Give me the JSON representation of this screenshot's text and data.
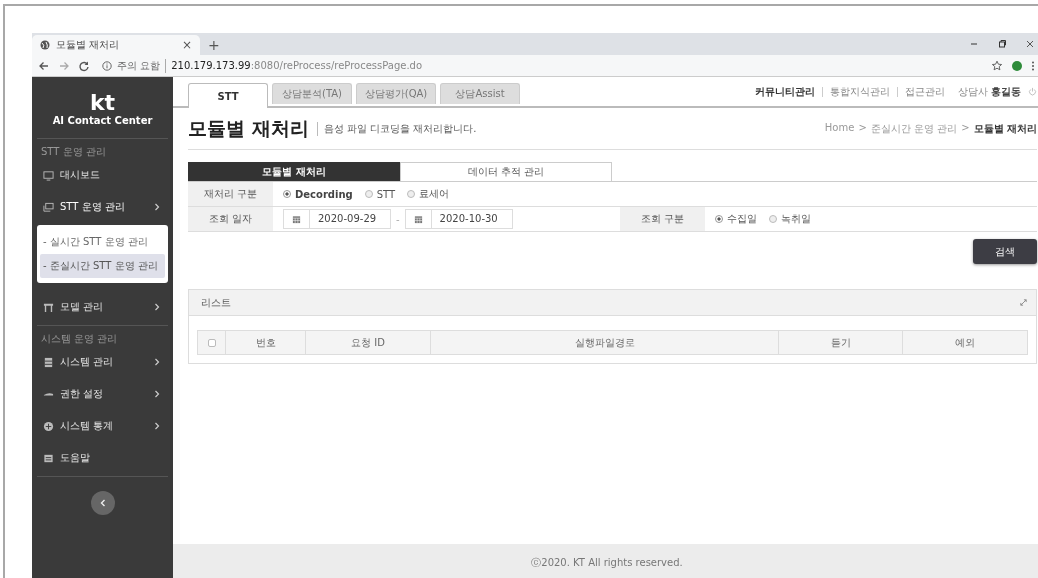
{
  "browser": {
    "tab_title": "모듈별 재처리",
    "tab_close": "×",
    "new_tab": "+",
    "security_label": "주의 요함",
    "url_host": "210.179.173.99",
    "url_path": ":8080/reProcess/reProcessPage.do"
  },
  "sidebar": {
    "logo": "kt",
    "subtitle": "AI Contact Center",
    "sections": [
      {
        "label": "STT 운영 관리",
        "items": [
          {
            "label": "대시보드",
            "has_arrow": false
          },
          {
            "label": "STT 운영 관리",
            "has_arrow": true,
            "expanded": true,
            "children": [
              {
                "label": "- 실시간 STT 운영 관리",
                "selected": false
              },
              {
                "label": "- 준실시간 STT 운영 관리",
                "selected": true
              }
            ]
          },
          {
            "label": "모델 관리",
            "has_arrow": true
          }
        ]
      },
      {
        "label": "시스템 운영 관리",
        "items": [
          {
            "label": "시스템 관리",
            "has_arrow": true
          },
          {
            "label": "권한 설정",
            "has_arrow": true
          },
          {
            "label": "시스템 통계",
            "has_arrow": true
          },
          {
            "label": "도움말",
            "has_arrow": false
          }
        ]
      }
    ]
  },
  "top_tabs": [
    {
      "label": "STT",
      "selected": true
    },
    {
      "label": "상담분석(TA)",
      "selected": false
    },
    {
      "label": "상담평가(QA)",
      "selected": false
    },
    {
      "label": "상담Assist",
      "selected": false
    }
  ],
  "top_links": [
    {
      "label": "커뮤니티관리",
      "bold": true
    },
    {
      "label": "통합지식관리",
      "bold": false
    },
    {
      "label": "접근관리",
      "bold": false
    }
  ],
  "user": {
    "role": "상담사",
    "name": "홍길동"
  },
  "page": {
    "title": "모듈별 재처리",
    "description": "음성 파일 디코딩을 재처리합니다.",
    "breadcrumb": [
      "Home",
      "준실시간 운영 관리",
      "모듈별 재처리"
    ],
    "breadcrumb_separator": ">"
  },
  "sub_tabs": [
    {
      "label": "모듈별 재처리",
      "selected": true
    },
    {
      "label": "데이터 추적 관리",
      "selected": false
    }
  ],
  "form": {
    "reprocess_type": {
      "label": "재처리 구분",
      "options": [
        {
          "label": "Decording",
          "selected": true
        },
        {
          "label": "STT",
          "selected": false
        },
        {
          "label": "료세어",
          "selected": false
        }
      ]
    },
    "query_date": {
      "label": "조회 일자",
      "from": "2020-09-29",
      "separator": "-",
      "to": "2020-10-30"
    },
    "query_type": {
      "label": "조회 구분",
      "options": [
        {
          "label": "수집일",
          "selected": true
        },
        {
          "label": "녹취일",
          "selected": false
        }
      ]
    }
  },
  "search_button": "검색",
  "list": {
    "title": "리스트",
    "select_all_checked": false,
    "columns": [
      "번호",
      "요청 ID",
      "실행파일경로",
      "듣기",
      "예외"
    ]
  },
  "footer": "ⓒ2020. KT All rights reserved."
}
